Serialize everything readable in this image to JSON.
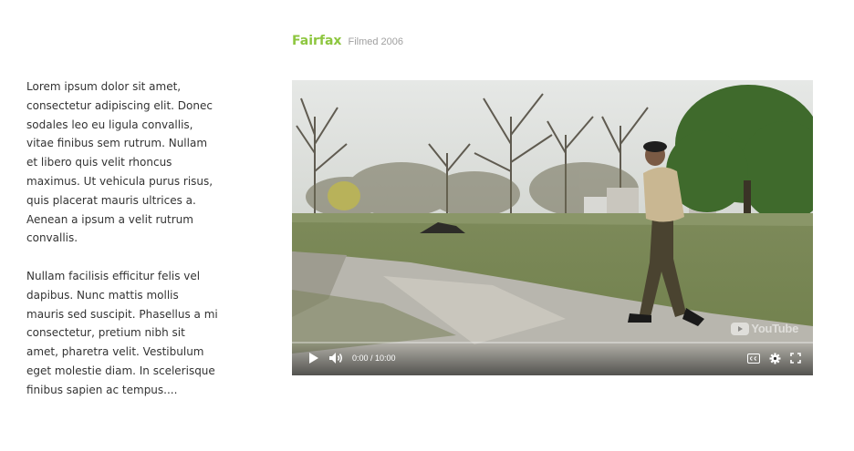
{
  "header": {
    "title": "Fairfax",
    "subtitle": "Filmed 2006"
  },
  "body_text": {
    "paragraphs": [
      "Lorem ipsum dolor sit amet, consectetur adipiscing elit. Donec sodales leo eu ligula convallis, vitae finibus sem rutrum. Nullam et libero quis velit rhoncus maximus. Ut vehicula purus risus, quis placerat mauris ultrices a. Aenean a ipsum a velit rutrum convallis.",
      "Nullam facilisis efficitur felis vel dapibus. Nunc mattis mollis mauris sed suscipit. Phasellus a mi consectetur, pretium nibh sit amet, pharetra velit. Vestibulum eget molestie diam. In scelerisque finibus sapien ac tempus...."
    ]
  },
  "video": {
    "watermark": "YouTube",
    "time_display": "0:00 / 10:00",
    "progress": 0,
    "icons": {
      "play": "play-icon",
      "volume": "volume-icon",
      "captions": "captions-icon",
      "settings": "gear-icon",
      "fullscreen": "fullscreen-icon"
    },
    "colors": {
      "accent": "#8dc63f",
      "progress": "#ff0000"
    }
  }
}
